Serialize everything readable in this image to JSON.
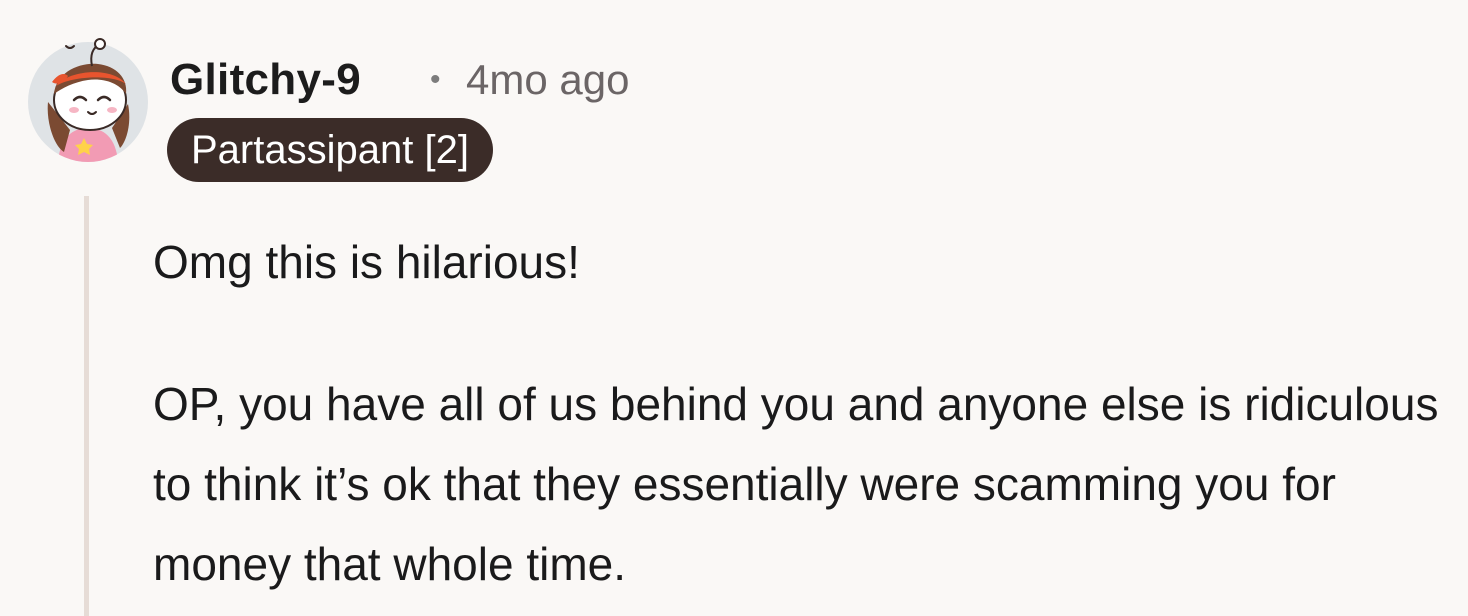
{
  "comment": {
    "author": "Glitchy-9",
    "separator": "•",
    "time_ago": "4mo ago",
    "flair": "Partassipant [2]",
    "paragraphs": [
      "Omg this is hilarious!",
      "OP, you have all of us behind you and anyone else is ridiculous to think it’s ok that they essentially were scamming you for money that whole time."
    ]
  },
  "colors": {
    "background": "#faf8f6",
    "flair_background": "#3b2c28",
    "flair_text": "#ffffff",
    "thread_line": "#e6dcd6",
    "meta_text": "#6b6566"
  },
  "icons": {
    "avatar": "snoo-avatar-icon"
  }
}
